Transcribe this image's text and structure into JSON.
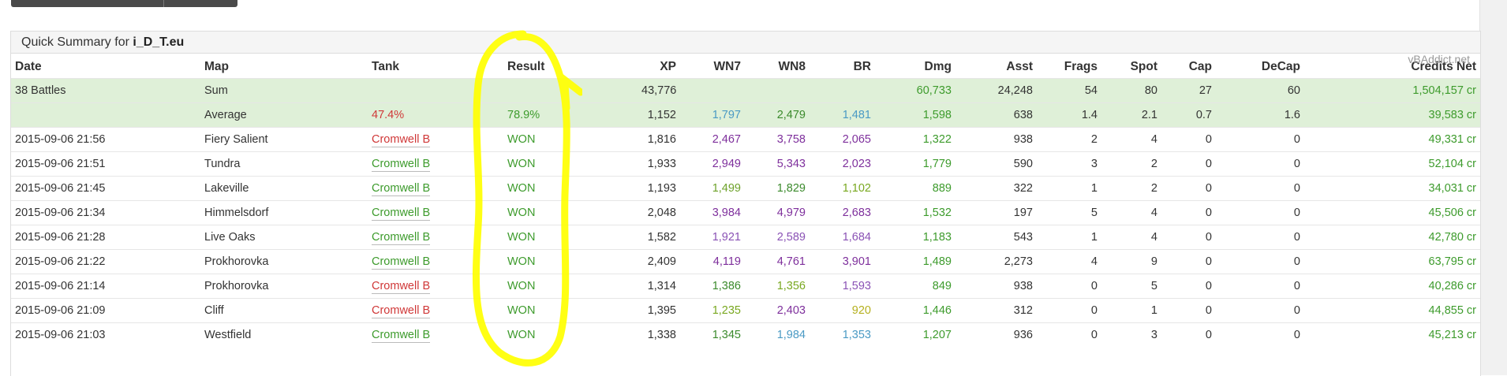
{
  "summary_label": "Quick Summary for",
  "player": "i_D_T.eu",
  "watermark": "vBAddict.net",
  "columns": [
    "Date",
    "Map",
    "Tank",
    "Result",
    "XP",
    "WN7",
    "WN8",
    "BR",
    "Dmg",
    "Asst",
    "Frags",
    "Spot",
    "Cap",
    "DeCap",
    "Credits Net"
  ],
  "sum": {
    "date": "38 Battles",
    "map": "Sum",
    "xp": "43,776",
    "dmg": "60,733",
    "asst": "24,248",
    "frags": "54",
    "spot": "80",
    "cap": "27",
    "decap": "60",
    "credits": "1,504,157 cr"
  },
  "avg": {
    "map": "Average",
    "tank": "47.4%",
    "result": "78.9%",
    "xp": "1,152",
    "wn7": "1,797",
    "wn8": "2,479",
    "br": "1,481",
    "dmg": "1,598",
    "asst": "638",
    "frags": "1.4",
    "spot": "2.1",
    "cap": "0.7",
    "decap": "1.6",
    "credits": "39,583 cr"
  },
  "rows": [
    {
      "date": "2015-09-06 21:56",
      "map": "Fiery Salient",
      "tank": "Cromwell B",
      "result": "WON",
      "xp": "1,816",
      "wn7": "2,467",
      "wn8": "3,758",
      "br": "2,065",
      "dmg": "1,322",
      "asst": "938",
      "frags": "2",
      "spot": "4",
      "cap": "0",
      "decap": "0",
      "credits": "49,331 cr"
    },
    {
      "date": "2015-09-06 21:51",
      "map": "Tundra",
      "tank": "Cromwell B",
      "result": "WON",
      "xp": "1,933",
      "wn7": "2,949",
      "wn8": "5,343",
      "br": "2,023",
      "dmg": "1,779",
      "asst": "590",
      "frags": "3",
      "spot": "2",
      "cap": "0",
      "decap": "0",
      "credits": "52,104 cr"
    },
    {
      "date": "2015-09-06 21:45",
      "map": "Lakeville",
      "tank": "Cromwell B",
      "result": "WON",
      "xp": "1,193",
      "wn7": "1,499",
      "wn8": "1,829",
      "br": "1,102",
      "dmg": "889",
      "asst": "322",
      "frags": "1",
      "spot": "2",
      "cap": "0",
      "decap": "0",
      "credits": "34,031 cr"
    },
    {
      "date": "2015-09-06 21:34",
      "map": "Himmelsdorf",
      "tank": "Cromwell B",
      "result": "WON",
      "xp": "2,048",
      "wn7": "3,984",
      "wn8": "4,979",
      "br": "2,683",
      "dmg": "1,532",
      "asst": "197",
      "frags": "5",
      "spot": "4",
      "cap": "0",
      "decap": "0",
      "credits": "45,506 cr"
    },
    {
      "date": "2015-09-06 21:28",
      "map": "Live Oaks",
      "tank": "Cromwell B",
      "result": "WON",
      "xp": "1,582",
      "wn7": "1,921",
      "wn8": "2,589",
      "br": "1,684",
      "dmg": "1,183",
      "asst": "543",
      "frags": "1",
      "spot": "4",
      "cap": "0",
      "decap": "0",
      "credits": "42,780 cr"
    },
    {
      "date": "2015-09-06 21:22",
      "map": "Prokhorovka",
      "tank": "Cromwell B",
      "result": "WON",
      "xp": "2,409",
      "wn7": "4,119",
      "wn8": "4,761",
      "br": "3,901",
      "dmg": "1,489",
      "asst": "2,273",
      "frags": "4",
      "spot": "9",
      "cap": "0",
      "decap": "0",
      "credits": "63,795 cr"
    },
    {
      "date": "2015-09-06 21:14",
      "map": "Prokhorovka",
      "tank": "Cromwell B",
      "result": "WON",
      "xp": "1,314",
      "wn7": "1,386",
      "wn8": "1,356",
      "br": "1,593",
      "dmg": "849",
      "asst": "938",
      "frags": "0",
      "spot": "5",
      "cap": "0",
      "decap": "0",
      "credits": "40,286 cr"
    },
    {
      "date": "2015-09-06 21:09",
      "map": "Cliff",
      "tank": "Cromwell B",
      "result": "WON",
      "xp": "1,395",
      "wn7": "1,235",
      "wn8": "2,403",
      "br": "920",
      "dmg": "1,446",
      "asst": "312",
      "frags": "0",
      "spot": "1",
      "cap": "0",
      "decap": "0",
      "credits": "44,855 cr"
    },
    {
      "date": "2015-09-06 21:03",
      "map": "Westfield",
      "tank": "Cromwell B",
      "result": "WON",
      "xp": "1,338",
      "wn7": "1,345",
      "wn8": "1,984",
      "br": "1,353",
      "dmg": "1,207",
      "asst": "936",
      "frags": "0",
      "spot": "3",
      "cap": "0",
      "decap": "0",
      "credits": "45,213 cr"
    }
  ],
  "colors": {
    "sum_bg": "#dff0d8",
    "won": "#3d9b2c",
    "loss_tank": "#d03838",
    "highlight": "#ffff00"
  }
}
